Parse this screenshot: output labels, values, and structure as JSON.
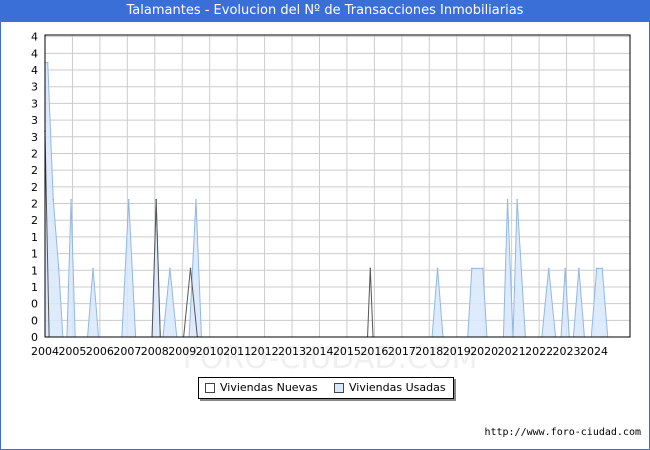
{
  "title": "Talamantes - Evolucion del Nº de Transacciones Inmobiliarias",
  "source": "http://www.foro-ciudad.com",
  "watermark": "FORO-CIUDAD.COM",
  "colors": {
    "title_bar": "#3a6fd8",
    "nuevas_stroke": "#555555",
    "usadas_fill": "#d8e8fb",
    "usadas_stroke": "#8fb8e6",
    "grid": "#cccccc"
  },
  "chart_data": {
    "type": "area",
    "title": "Talamantes - Evolucion del Nº de Transacciones Inmobiliarias",
    "xlabel": "",
    "ylabel": "",
    "ylim": [
      0,
      4.4
    ],
    "grid": true,
    "legend_position": "bottom-center",
    "x_ticks": [
      "2004",
      "2005",
      "2006",
      "2007",
      "2008",
      "2009",
      "2010",
      "2011",
      "2012",
      "2013",
      "2014",
      "2015",
      "2016",
      "2017",
      "2018",
      "2019",
      "2020",
      "2021",
      "2022",
      "2023",
      "2024"
    ],
    "y_ticks": [
      "0",
      "0",
      "0",
      "1",
      "1",
      "1",
      "1",
      "2",
      "2",
      "2",
      "2",
      "2",
      "3",
      "3",
      "3",
      "3",
      "4",
      "4",
      "4"
    ],
    "series": [
      {
        "name": "Viviendas Nuevas",
        "points": [
          [
            2004.0,
            3
          ],
          [
            2004.15,
            0
          ],
          [
            2007.9,
            0
          ],
          [
            2008.05,
            2
          ],
          [
            2008.2,
            0
          ],
          [
            2009.05,
            0
          ],
          [
            2009.3,
            1
          ],
          [
            2009.55,
            0
          ],
          [
            2015.75,
            0
          ],
          [
            2015.85,
            1
          ],
          [
            2015.95,
            0
          ]
        ]
      },
      {
        "name": "Viviendas Usadas",
        "points": [
          [
            2004.0,
            4
          ],
          [
            2004.1,
            4
          ],
          [
            2004.3,
            2
          ],
          [
            2004.5,
            1
          ],
          [
            2004.65,
            0
          ],
          [
            2004.8,
            0
          ],
          [
            2004.95,
            2
          ],
          [
            2005.1,
            0
          ],
          [
            2005.55,
            0
          ],
          [
            2005.75,
            1
          ],
          [
            2005.95,
            0
          ],
          [
            2006.8,
            0
          ],
          [
            2007.05,
            2
          ],
          [
            2007.3,
            0
          ],
          [
            2007.9,
            0
          ],
          [
            2008.05,
            2
          ],
          [
            2008.2,
            0
          ],
          [
            2008.3,
            0
          ],
          [
            2008.55,
            1
          ],
          [
            2008.8,
            0
          ],
          [
            2009.25,
            0
          ],
          [
            2009.5,
            2
          ],
          [
            2009.7,
            0
          ],
          [
            2018.1,
            0
          ],
          [
            2018.3,
            1
          ],
          [
            2018.5,
            0
          ],
          [
            2019.4,
            0
          ],
          [
            2019.55,
            1
          ],
          [
            2019.95,
            1
          ],
          [
            2020.1,
            0
          ],
          [
            2020.7,
            0
          ],
          [
            2020.85,
            2
          ],
          [
            2021.05,
            0
          ],
          [
            2021.2,
            2
          ],
          [
            2021.5,
            0
          ],
          [
            2022.1,
            0
          ],
          [
            2022.35,
            1
          ],
          [
            2022.6,
            0
          ],
          [
            2022.8,
            0
          ],
          [
            2022.95,
            1
          ],
          [
            2023.1,
            0
          ],
          [
            2023.25,
            0
          ],
          [
            2023.45,
            1
          ],
          [
            2023.65,
            0
          ],
          [
            2023.9,
            0
          ],
          [
            2024.1,
            1
          ],
          [
            2024.3,
            1
          ],
          [
            2024.5,
            0
          ]
        ]
      }
    ]
  },
  "legend": {
    "nuevas": "Viviendas Nuevas",
    "usadas": "Viviendas Usadas"
  }
}
